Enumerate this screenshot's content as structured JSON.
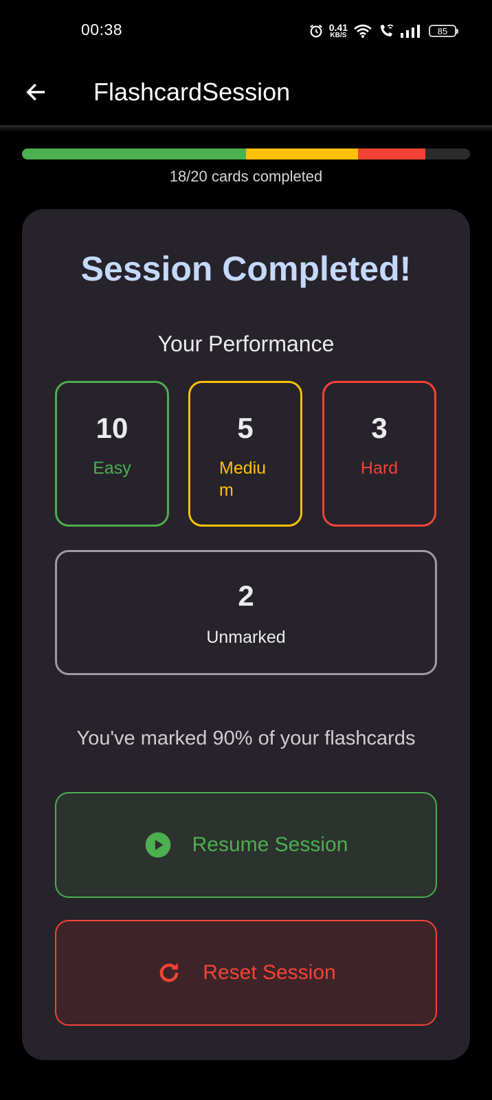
{
  "status_bar": {
    "time": "00:38",
    "net_speed_value": "0.41",
    "net_speed_unit": "KB/S",
    "battery": "85",
    "icons": [
      "alarm-icon",
      "wifi-icon",
      "wifi-call-icon",
      "signal-icon",
      "battery-icon"
    ]
  },
  "app_bar": {
    "title": "FlashcardSession",
    "back_icon": "arrow-back-icon"
  },
  "progress": {
    "label": "18/20 cards completed",
    "total": 20,
    "segments": [
      {
        "name": "Easy",
        "count": 10,
        "color": "#4caf50"
      },
      {
        "name": "Medium",
        "count": 5,
        "color": "#ffc107"
      },
      {
        "name": "Hard",
        "count": 3,
        "color": "#f44336"
      }
    ]
  },
  "summary": {
    "title": "Session Completed!",
    "performance_heading": "Your Performance",
    "easy": {
      "count": "10",
      "label": "Easy"
    },
    "medium": {
      "count": "5",
      "label": "Medium"
    },
    "hard": {
      "count": "3",
      "label": "Hard"
    },
    "unmarked": {
      "count": "2",
      "label": "Unmarked"
    },
    "marked_text": "You've marked 90% of your flashcards"
  },
  "actions": {
    "resume_label": "Resume Session",
    "resume_icon": "play-circle-icon",
    "reset_label": "Reset Session",
    "reset_icon": "refresh-icon"
  },
  "colors": {
    "easy": "#4caf50",
    "medium": "#ffc107",
    "hard": "#f44336",
    "title": "#c4d8ff",
    "card_bg": "#27232a"
  }
}
